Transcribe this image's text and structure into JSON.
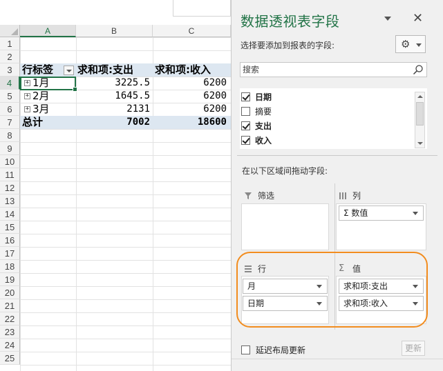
{
  "sheet": {
    "columns": [
      "A",
      "B",
      "C"
    ],
    "rows": [
      "1",
      "2",
      "3",
      "4",
      "5",
      "6",
      "7",
      "8",
      "9",
      "10",
      "11",
      "12",
      "13",
      "14",
      "15",
      "16",
      "17",
      "18",
      "19",
      "20",
      "21",
      "22",
      "23",
      "24",
      "25"
    ],
    "pivot": {
      "header": {
        "row_labels": "行标签",
        "sum_expense": "求和项:支出",
        "sum_income": "求和项:收入"
      },
      "data_rows": [
        {
          "label": "1月",
          "expense": "3225.5",
          "income": "6200"
        },
        {
          "label": "2月",
          "expense": "1645.5",
          "income": "6200"
        },
        {
          "label": "3月",
          "expense": "2131",
          "income": "6200"
        }
      ],
      "total": {
        "label": "总计",
        "expense": "7002",
        "income": "18600"
      }
    }
  },
  "pane": {
    "title": "数据透视表字段",
    "close_glyph": "✕",
    "choose_label": "选择要添加到报表的字段:",
    "search_placeholder": "搜索",
    "fields": [
      {
        "name": "日期",
        "checked": true
      },
      {
        "name": "摘要",
        "checked": false
      },
      {
        "name": "支出",
        "checked": true
      },
      {
        "name": "收入",
        "checked": true
      }
    ],
    "drag_label": "在以下区域间拖动字段:",
    "areas": {
      "filters": {
        "title": "筛选",
        "items": []
      },
      "columns": {
        "title": "列",
        "items": [
          "Σ 数值"
        ]
      },
      "rows": {
        "title": "行",
        "items": [
          "月",
          "日期"
        ]
      },
      "values": {
        "title": "值",
        "items": [
          "求和项:支出",
          "求和项:收入"
        ]
      }
    },
    "defer_label": "延迟布局更新",
    "update_label": "更新"
  },
  "colors": {
    "accent": "#217346",
    "highlight": "#f28c1e",
    "band": "#dde7f1"
  }
}
